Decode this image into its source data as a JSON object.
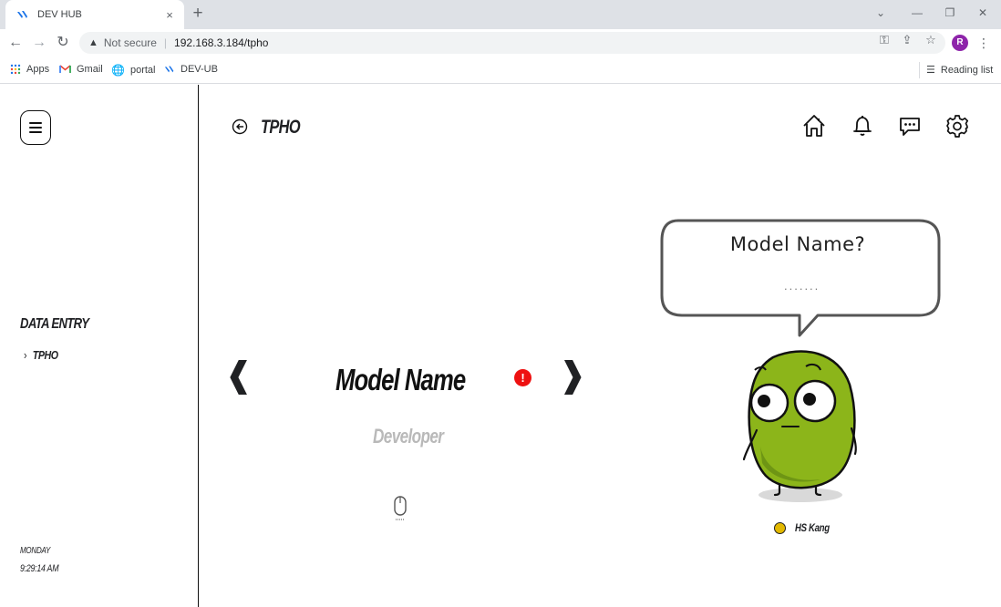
{
  "browser": {
    "tab_title": "DEV HUB",
    "tab_close": "×",
    "new_tab": "+",
    "minimize": "⌄",
    "restore": "—",
    "maximize": "❐",
    "close": "✕",
    "back": "←",
    "forward": "→",
    "reload": "↻",
    "not_secure": "Not secure",
    "url": "192.168.3.184/tpho",
    "profile_initial": "R",
    "bookmarks": [
      "Apps",
      "Gmail",
      "portal",
      "DEV-UB"
    ],
    "reading_list": "Reading list"
  },
  "sidebar": {
    "section_title": "DATA ENTRY",
    "items": [
      {
        "label": "TPHO",
        "chevron": "›"
      }
    ],
    "day": "MONDAY",
    "time": "9:29:14 AM"
  },
  "header": {
    "title": "TPHO",
    "icons": [
      "home-icon",
      "bell-icon",
      "chat-icon",
      "gear-icon"
    ]
  },
  "carousel": {
    "prev": "❰",
    "next": "❱",
    "title": "Model Name",
    "alert": "!",
    "subtitle": "Developer"
  },
  "speech_bubble": {
    "title": "Model Name?",
    "dots": "......."
  },
  "mascot": {
    "author": "HS Kang",
    "body_color": "#8cb51a"
  }
}
